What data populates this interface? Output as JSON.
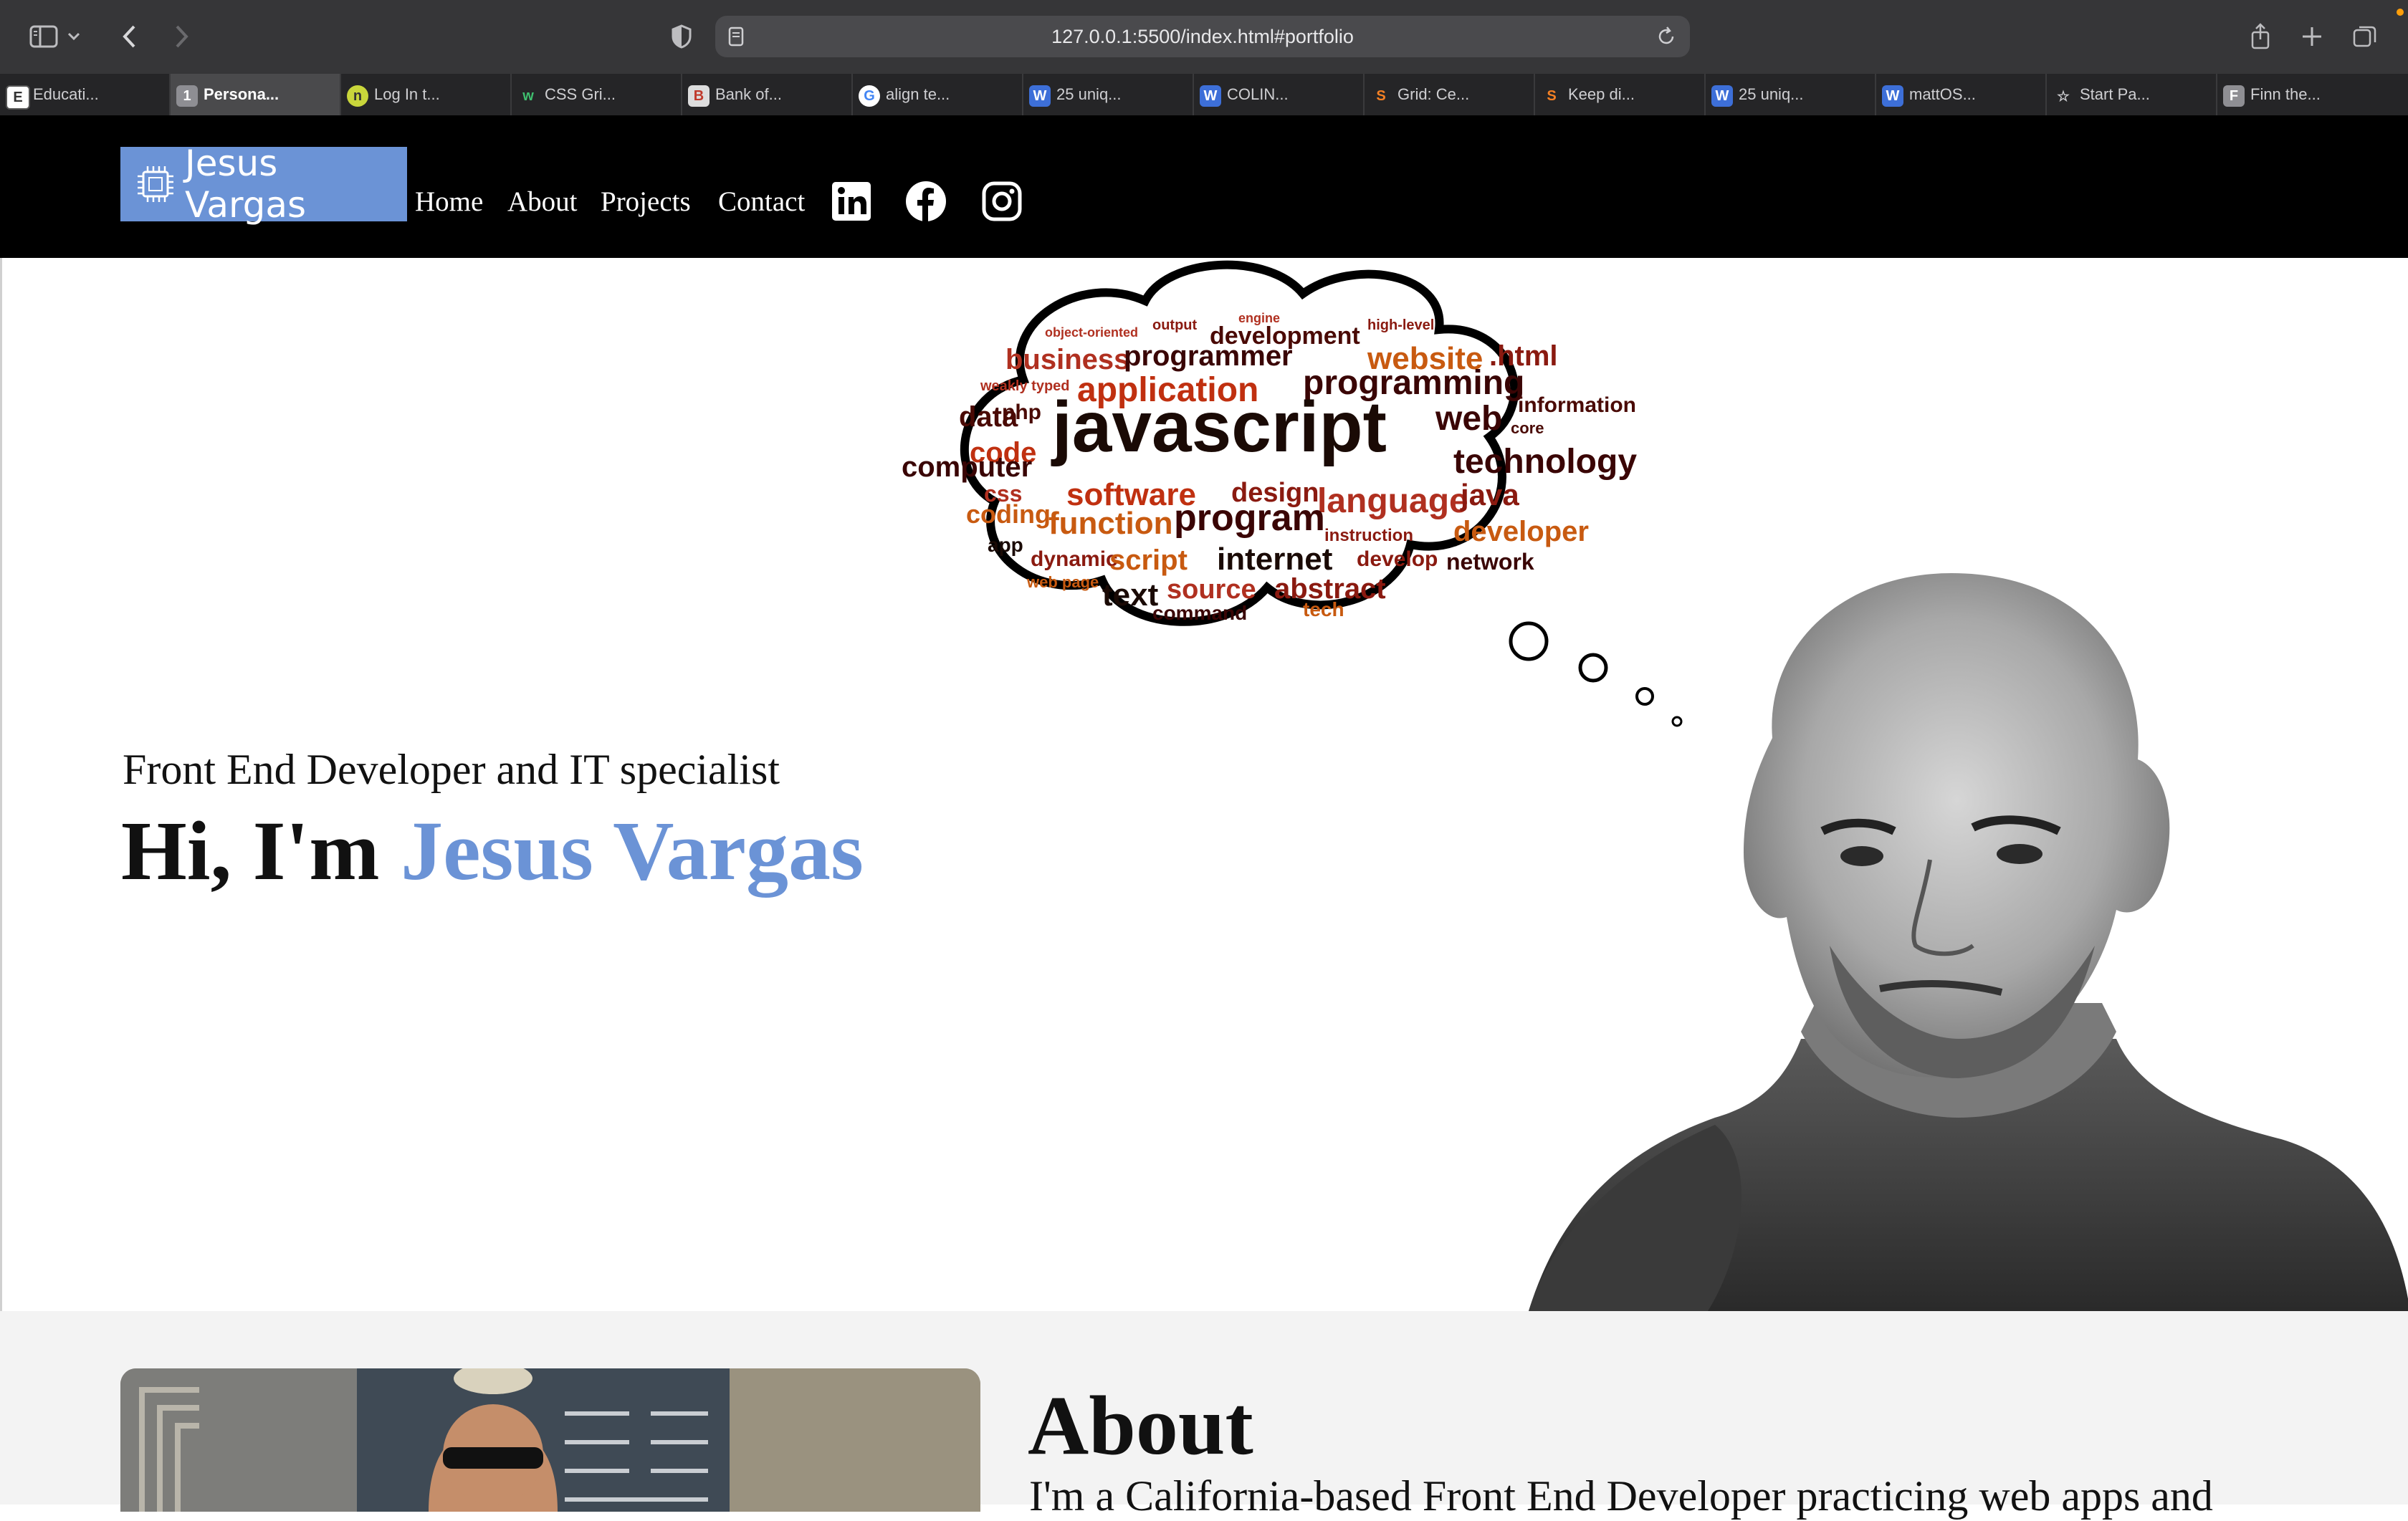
{
  "browser": {
    "url": "127.0.0.1:5500/index.html#portfolio",
    "tabs": [
      {
        "label": "Educati...",
        "favicon": "E",
        "active": false
      },
      {
        "label": "Persona...",
        "favicon": "1",
        "active": true
      },
      {
        "label": "Log In t...",
        "favicon": "n",
        "active": false
      },
      {
        "label": "CSS Gri...",
        "favicon": "w",
        "active": false
      },
      {
        "label": "Bank of...",
        "favicon": "B",
        "active": false
      },
      {
        "label": "align te...",
        "favicon": "G",
        "active": false
      },
      {
        "label": "25 uniq...",
        "favicon": "W",
        "active": false
      },
      {
        "label": "COLIN...",
        "favicon": "W",
        "active": false
      },
      {
        "label": "Grid: Ce...",
        "favicon": "S",
        "active": false
      },
      {
        "label": "Keep di...",
        "favicon": "S",
        "active": false
      },
      {
        "label": "25 uniq...",
        "favicon": "W",
        "active": false
      },
      {
        "label": "mattOS...",
        "favicon": "W",
        "active": false
      },
      {
        "label": "Start Pa...",
        "favicon": "☆",
        "active": false
      },
      {
        "label": "Finn the...",
        "favicon": "F",
        "active": false
      }
    ]
  },
  "nav": {
    "logo_text": "Jesus Vargas",
    "links": [
      "Home",
      "About",
      "Projects",
      "Contact"
    ],
    "social_icons": [
      "linkedin-icon",
      "facebook-icon",
      "instagram-icon"
    ]
  },
  "hero": {
    "subtitle": "Front End Developer and IT specialist",
    "greeting": "Hi, I'm ",
    "name": "Jesus Vargas"
  },
  "word_cloud": {
    "words": [
      "javascript",
      "programmer",
      "development",
      "application",
      "programming",
      "website",
      "html",
      "business",
      "software",
      "design",
      "language",
      "function",
      "program",
      "internet",
      "script",
      "dynamic",
      "source",
      "abstract",
      "command",
      "technology",
      "information",
      "network",
      "developer",
      "computer",
      "code",
      "data",
      "css",
      "php",
      "app",
      "tech",
      "output",
      "engine",
      "text",
      "web page",
      "coding",
      "java"
    ]
  },
  "about": {
    "title": "About",
    "text": "I'm a California-based Front End Developer practicing web apps and"
  },
  "colors": {
    "accent": "#6b93d6",
    "nav_bg": "#000000",
    "about_bg": "#f3f3f3"
  }
}
